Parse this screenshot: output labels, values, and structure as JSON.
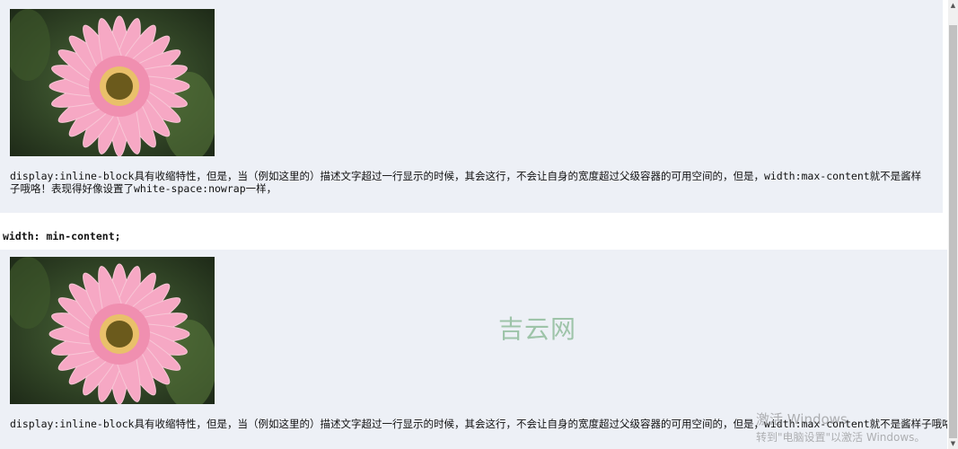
{
  "sections": [
    {
      "description": "display:inline-block具有收缩特性，但是，当（例如这里的）描述文字超过一行显示的时候，其会这行，不会让自身的宽度超过父级容器的可用空间的，但是，width:max-content就不是酱样子哦咯！表现得好像设置了white-space:nowrap一样，"
    },
    {
      "heading": "width: min-content;",
      "description": "display:inline-block具有收缩特性，但是，当（例如这里的）描述文字超过一行显示的时候，其会这行，不会让自身的宽度超过父级容器的可用空间的，但是，width:max-content就不是酱样子哦咯！表现得好像设置了white-space:nowrap一样，"
    }
  ],
  "watermark": "吉云网",
  "windows_activation": {
    "line1": "激活 Windows",
    "line2": "转到\"电脑设置\"以激活 Windows。"
  },
  "scrollbar": {
    "up_arrow": "▲",
    "down_arrow": "▼"
  },
  "images": {
    "flower_icon": "pink-gerbera-daisy-image"
  }
}
